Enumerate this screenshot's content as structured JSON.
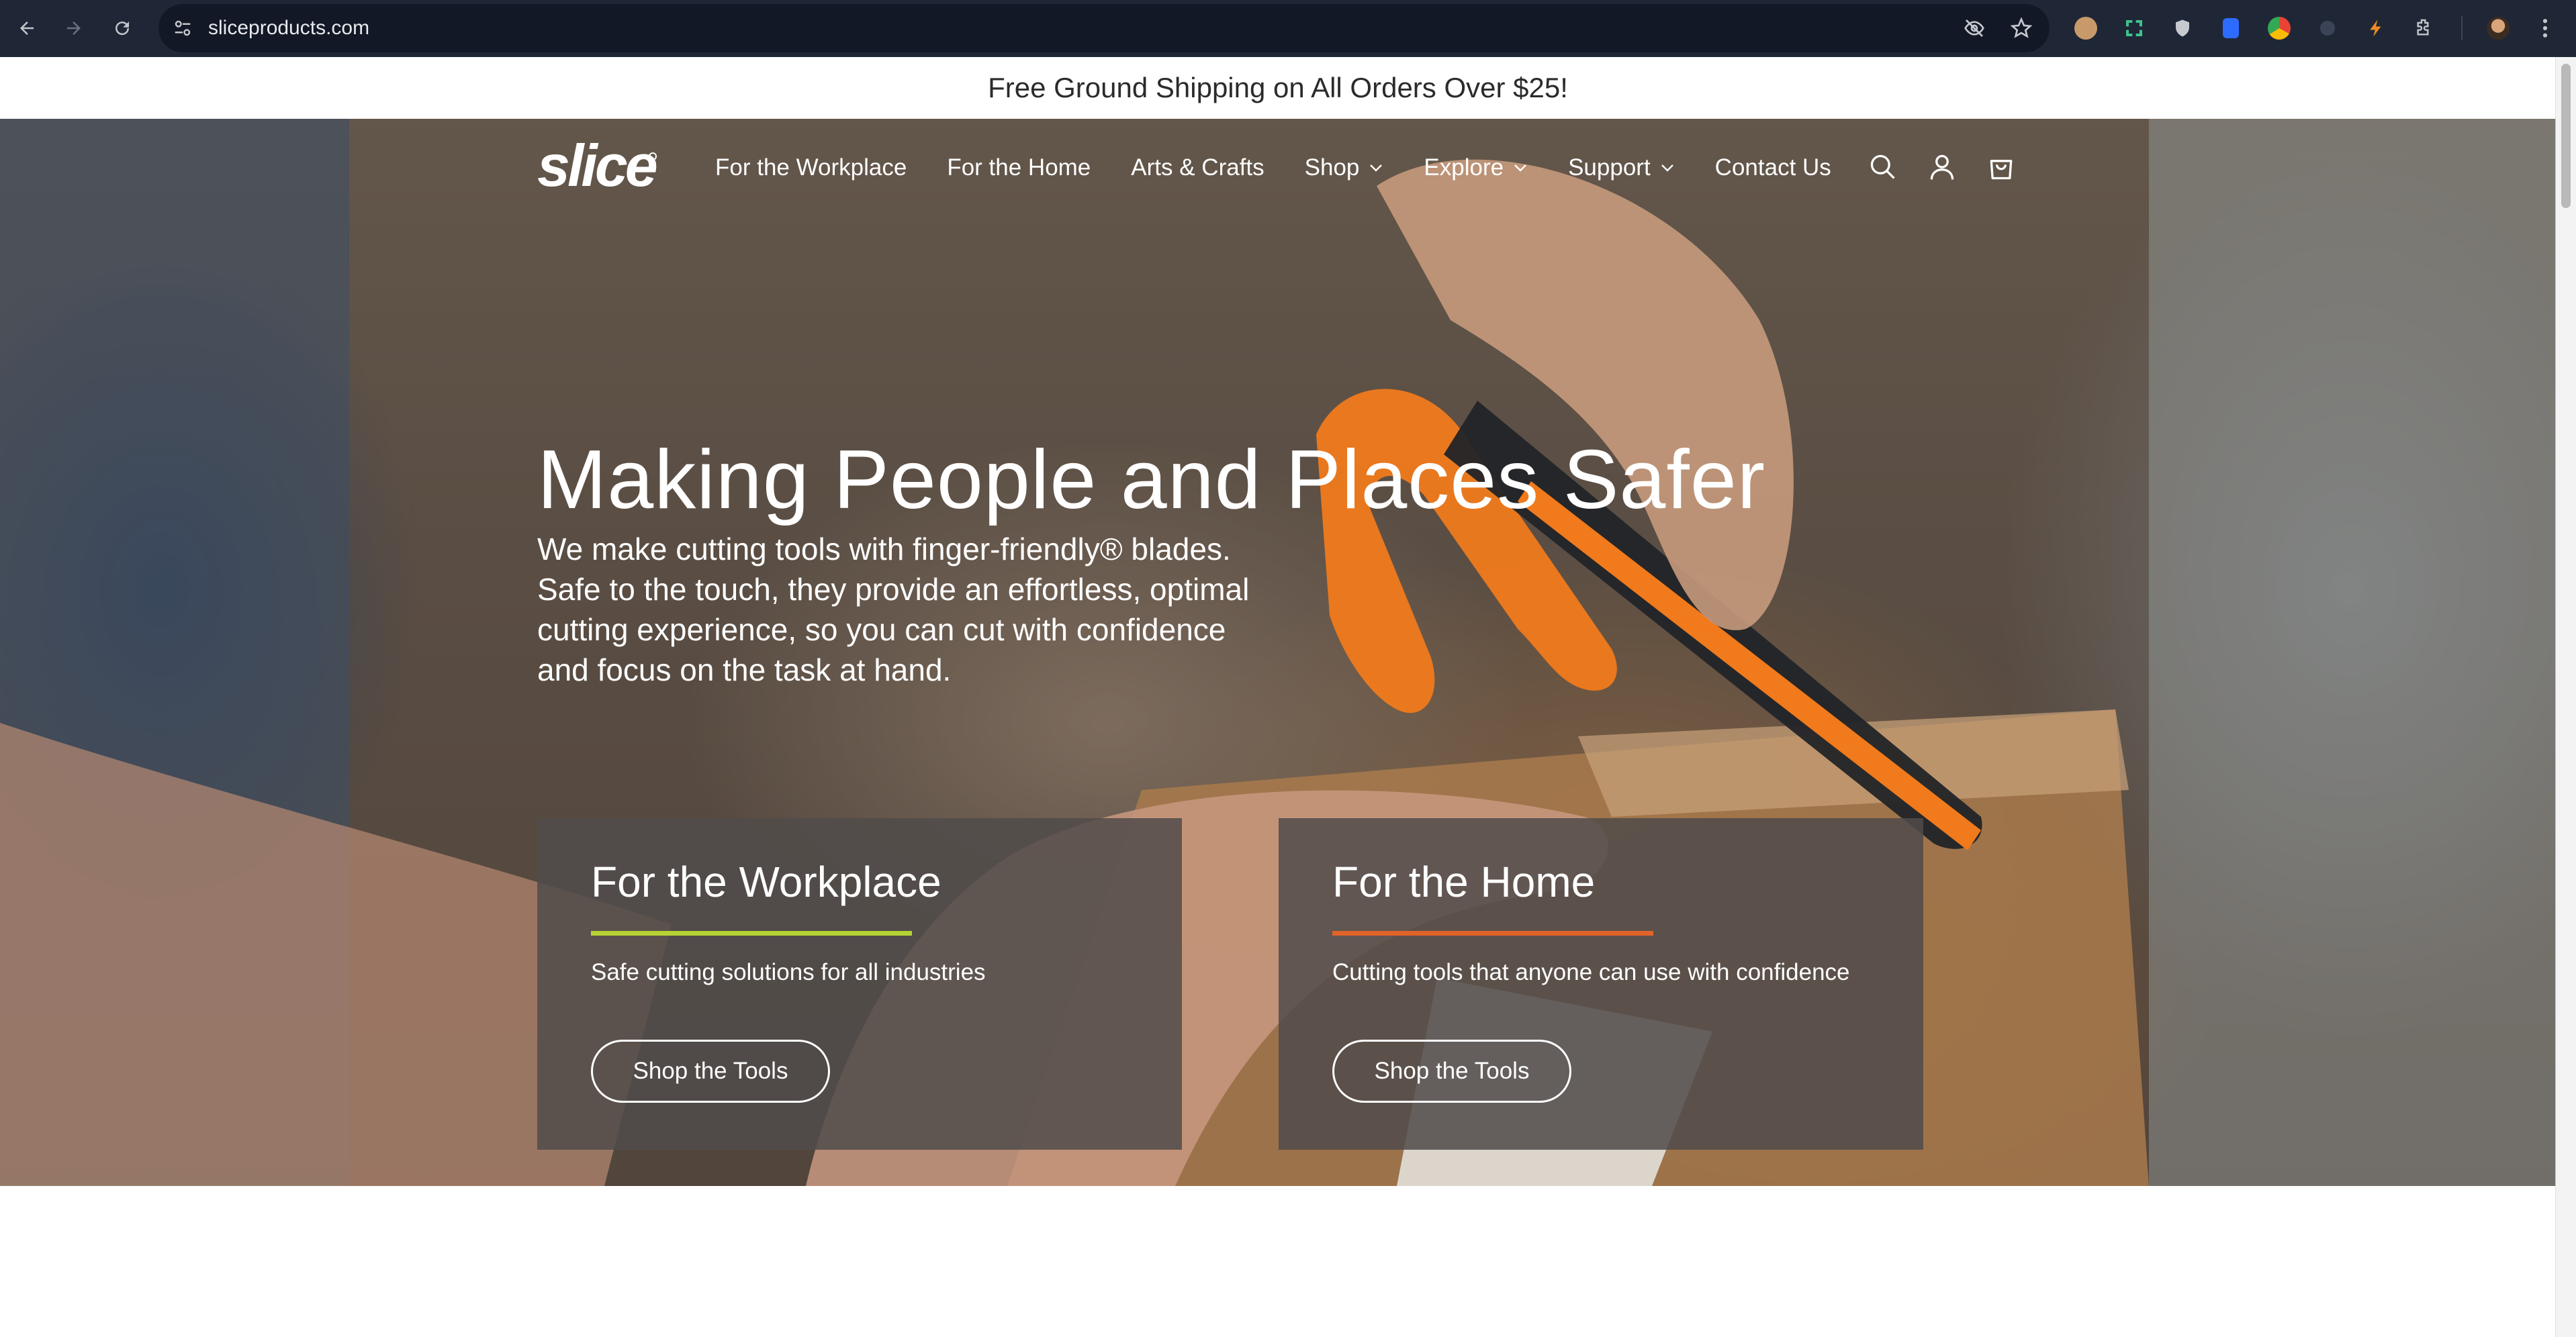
{
  "browser": {
    "url": "sliceproducts.com"
  },
  "announcement": "Free Ground Shipping on All Orders Over $25!",
  "header": {
    "logo_text": "slice",
    "nav": [
      {
        "label": "For the Workplace"
      },
      {
        "label": "For the Home"
      },
      {
        "label": "Arts & Crafts"
      },
      {
        "label": "Shop"
      },
      {
        "label": "Explore"
      },
      {
        "label": "Support"
      },
      {
        "label": "Contact Us"
      }
    ]
  },
  "hero": {
    "title": "Making People and Places Safer",
    "description": "We make cutting tools with finger-friendly® blades. Safe to the touch, they provide an effortless, optimal cutting experience, so you can cut with confidence and focus on the task at hand."
  },
  "cards": [
    {
      "title": "For the Workplace",
      "description": "Safe cutting solutions for all industries",
      "button": "Shop the Tools",
      "accent": "#b5d334"
    },
    {
      "title": "For the Home",
      "description": "Cutting tools that anyone can use with confidence",
      "button": "Shop the Tools",
      "accent": "#e0632a"
    }
  ],
  "colors": {
    "chrome_bg": "#1f2737",
    "omnibox_bg": "#121826",
    "tool_orange": "#f07a1c"
  }
}
